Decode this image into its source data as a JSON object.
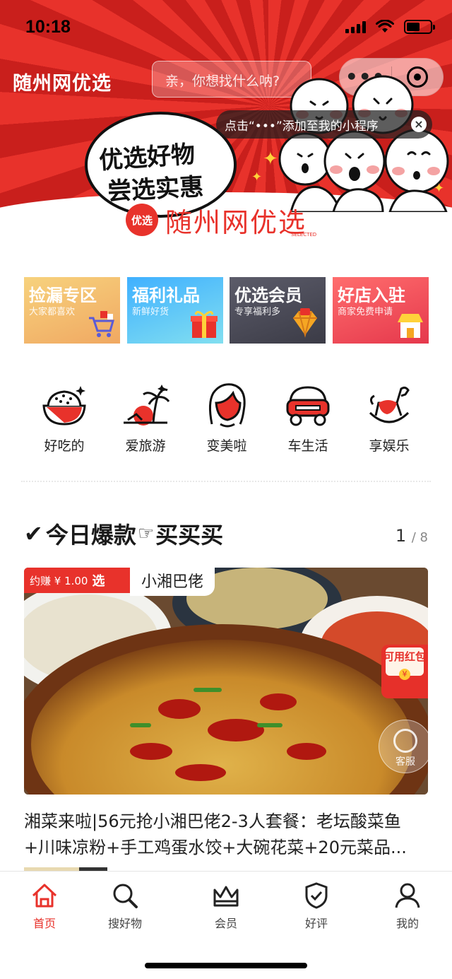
{
  "status_bar": {
    "time": "10:18"
  },
  "header": {
    "app_title": "随州网优选",
    "search_placeholder": "亲，你想找什么呐?",
    "capsule_more": "•••"
  },
  "tip": {
    "text": "点击“•••”添加至我的小程序"
  },
  "banner": {
    "slogan_line1": "优选好物",
    "slogan_line2": "尝选实惠",
    "brand_logo_text": "优选",
    "brand_name": "随州网优选",
    "brand_sub": "SELECTED"
  },
  "promos": [
    {
      "title": "捡漏专区",
      "subtitle": "大家都喜欢",
      "color_top": "#f6cf76",
      "color_bottom": "#f1a860"
    },
    {
      "title": "福利礼品",
      "subtitle": "新鲜好货",
      "color_top": "#4bb8ff",
      "color_bottom": "#7bd8f0"
    },
    {
      "title": "优选会员",
      "subtitle": "专享福利多",
      "color_top": "#5a5a68",
      "color_bottom": "#3d3d48"
    },
    {
      "title": "好店入驻",
      "subtitle": "商家免费申请",
      "color_top": "#ff6a6a",
      "color_bottom": "#e83a4c"
    }
  ],
  "categories": [
    {
      "label": "好吃的",
      "icon": "rice-bowl-icon"
    },
    {
      "label": "爱旅游",
      "icon": "palm-beach-icon"
    },
    {
      "label": "变美啦",
      "icon": "woman-face-icon"
    },
    {
      "label": "车生活",
      "icon": "car-icon"
    },
    {
      "label": "享娱乐",
      "icon": "rocking-horse-icon"
    }
  ],
  "section": {
    "title_prefix": "今日爆款",
    "title_suffix": "买买买",
    "pager_current": "1",
    "pager_total": "/ 8"
  },
  "product": {
    "earn_label": "约赚 ¥ 1.00",
    "earn_brand": "选",
    "shop_name": "小湘巴佬",
    "hongbao_text": "可用红包",
    "kefu_label": "客服",
    "title_line1": "湘菜来啦|56元抢小湘巴佬2-3人套餐：老坛酸菜鱼",
    "title_line2": "+川味凉粉+手工鸡蛋水饺+大碗花菜+20元菜品..."
  },
  "tabbar": [
    {
      "label": "首页",
      "icon": "home-icon",
      "active": true
    },
    {
      "label": "搜好物",
      "icon": "search-icon",
      "active": false
    },
    {
      "label": "会员",
      "icon": "crown-icon",
      "active": false
    },
    {
      "label": "好评",
      "icon": "shield-check-icon",
      "active": false
    },
    {
      "label": "我的",
      "icon": "user-icon",
      "active": false
    }
  ],
  "colors": {
    "brand_red": "#e8322b",
    "text": "#222222"
  }
}
